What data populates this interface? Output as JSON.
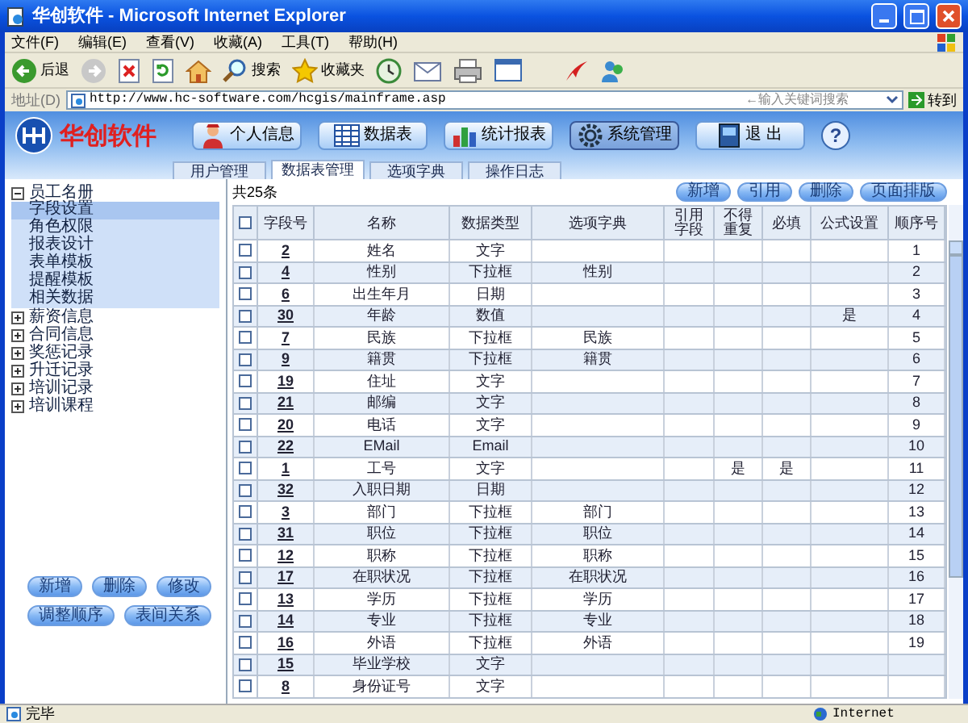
{
  "window": {
    "title": "华创软件 - Microsoft Internet Explorer"
  },
  "menu": [
    "文件(F)",
    "编辑(E)",
    "查看(V)",
    "收藏(A)",
    "工具(T)",
    "帮助(H)"
  ],
  "toolbar": [
    {
      "kind": "back",
      "label": "后退"
    },
    {
      "kind": "forward"
    },
    {
      "kind": "stop"
    },
    {
      "kind": "refresh"
    },
    {
      "kind": "home"
    },
    {
      "kind": "search",
      "label": "搜索"
    },
    {
      "kind": "favorites",
      "label": "收藏夹"
    },
    {
      "kind": "history"
    },
    {
      "kind": "mail"
    },
    {
      "kind": "print"
    },
    {
      "kind": "edit"
    },
    {
      "kind": "bird"
    },
    {
      "kind": "people"
    }
  ],
  "address": {
    "label": "地址(D)",
    "value": "http://www.hc-software.com/hcgis/mainframe.asp",
    "search_placeholder": "←输入关键词搜索",
    "go": "转到"
  },
  "header": {
    "logo": "华创软件",
    "help": "?",
    "nav": [
      {
        "kind": "person",
        "label": "个人信息",
        "selected": false
      },
      {
        "kind": "table",
        "label": "数据表",
        "selected": false
      },
      {
        "kind": "chart",
        "label": "统计报表",
        "selected": false
      },
      {
        "kind": "gear",
        "label": "系统管理",
        "selected": true
      },
      {
        "kind": "exit",
        "label": "退 出",
        "selected": false
      }
    ]
  },
  "tabs": [
    {
      "label": "用户管理",
      "selected": false
    },
    {
      "label": "数据表管理",
      "selected": true
    },
    {
      "label": "选项字典",
      "selected": false
    },
    {
      "label": "操作日志",
      "selected": false
    }
  ],
  "sidebar": {
    "tree": [
      {
        "label": "员工名册",
        "expanded": true,
        "children": [
          {
            "label": "字段设置",
            "selected": true
          },
          {
            "label": "角色权限",
            "selected": false
          },
          {
            "label": "报表设计",
            "selected": false
          },
          {
            "label": "表单模板",
            "selected": false
          },
          {
            "label": "提醒模板",
            "selected": false
          },
          {
            "label": "相关数据",
            "selected": false
          }
        ]
      },
      {
        "label": "薪资信息",
        "expanded": false
      },
      {
        "label": "合同信息",
        "expanded": false
      },
      {
        "label": "奖惩记录",
        "expanded": false
      },
      {
        "label": "升迁记录",
        "expanded": false
      },
      {
        "label": "培训记录",
        "expanded": false
      },
      {
        "label": "培训课程",
        "expanded": false
      }
    ],
    "buttons": [
      [
        "新增",
        "删除",
        "修改"
      ],
      [
        "调整顺序",
        "表间关系"
      ]
    ]
  },
  "table": {
    "count": "共25条",
    "all_checked": false,
    "buttons": [
      "新增",
      "引用",
      "删除",
      "页面排版"
    ],
    "columns": [
      "字段号",
      "名称",
      "数据类型",
      "选项字典",
      "引用字段",
      "不得重复",
      "必填",
      "公式设置",
      "顺序号"
    ],
    "rows": [
      {
        "checked": false,
        "cells": [
          "2",
          "姓名",
          "文字",
          "",
          "",
          "",
          "",
          "",
          "1"
        ]
      },
      {
        "checked": false,
        "cells": [
          "4",
          "性别",
          "下拉框",
          "性别",
          "",
          "",
          "",
          "",
          "2"
        ]
      },
      {
        "checked": false,
        "cells": [
          "6",
          "出生年月",
          "日期",
          "",
          "",
          "",
          "",
          "",
          "3"
        ]
      },
      {
        "checked": false,
        "cells": [
          "30",
          "年龄",
          "数值",
          "",
          "",
          "",
          "",
          "是",
          "4"
        ]
      },
      {
        "checked": false,
        "cells": [
          "7",
          "民族",
          "下拉框",
          "民族",
          "",
          "",
          "",
          "",
          "5"
        ]
      },
      {
        "checked": false,
        "cells": [
          "9",
          "籍贯",
          "下拉框",
          "籍贯",
          "",
          "",
          "",
          "",
          "6"
        ]
      },
      {
        "checked": false,
        "cells": [
          "19",
          "住址",
          "文字",
          "",
          "",
          "",
          "",
          "",
          "7"
        ]
      },
      {
        "checked": false,
        "cells": [
          "21",
          "邮编",
          "文字",
          "",
          "",
          "",
          "",
          "",
          "8"
        ]
      },
      {
        "checked": false,
        "cells": [
          "20",
          "电话",
          "文字",
          "",
          "",
          "",
          "",
          "",
          "9"
        ]
      },
      {
        "checked": false,
        "cells": [
          "22",
          "EMail",
          "Email",
          "",
          "",
          "",
          "",
          "",
          "10"
        ]
      },
      {
        "checked": false,
        "cells": [
          "1",
          "工号",
          "文字",
          "",
          "",
          "是",
          "是",
          "",
          "11"
        ]
      },
      {
        "checked": false,
        "cells": [
          "32",
          "入职日期",
          "日期",
          "",
          "",
          "",
          "",
          "",
          "12"
        ]
      },
      {
        "checked": false,
        "cells": [
          "3",
          "部门",
          "下拉框",
          "部门",
          "",
          "",
          "",
          "",
          "13"
        ]
      },
      {
        "checked": false,
        "cells": [
          "31",
          "职位",
          "下拉框",
          "职位",
          "",
          "",
          "",
          "",
          "14"
        ]
      },
      {
        "checked": false,
        "cells": [
          "12",
          "职称",
          "下拉框",
          "职称",
          "",
          "",
          "",
          "",
          "15"
        ]
      },
      {
        "checked": false,
        "cells": [
          "17",
          "在职状况",
          "下拉框",
          "在职状况",
          "",
          "",
          "",
          "",
          "16"
        ]
      },
      {
        "checked": false,
        "cells": [
          "13",
          "学历",
          "下拉框",
          "学历",
          "",
          "",
          "",
          "",
          "17"
        ]
      },
      {
        "checked": false,
        "cells": [
          "14",
          "专业",
          "下拉框",
          "专业",
          "",
          "",
          "",
          "",
          "18"
        ]
      },
      {
        "checked": false,
        "cells": [
          "16",
          "外语",
          "下拉框",
          "外语",
          "",
          "",
          "",
          "",
          "19"
        ]
      },
      {
        "checked": false,
        "cells": [
          "15",
          "毕业学校",
          "文字",
          "",
          "",
          "",
          "",
          "",
          ""
        ]
      },
      {
        "checked": false,
        "cells": [
          "8",
          "身份证号",
          "文字",
          "",
          "",
          "",
          "",
          "",
          ""
        ]
      }
    ]
  },
  "status_bar": {
    "text": "完毕",
    "zone": "Internet"
  }
}
